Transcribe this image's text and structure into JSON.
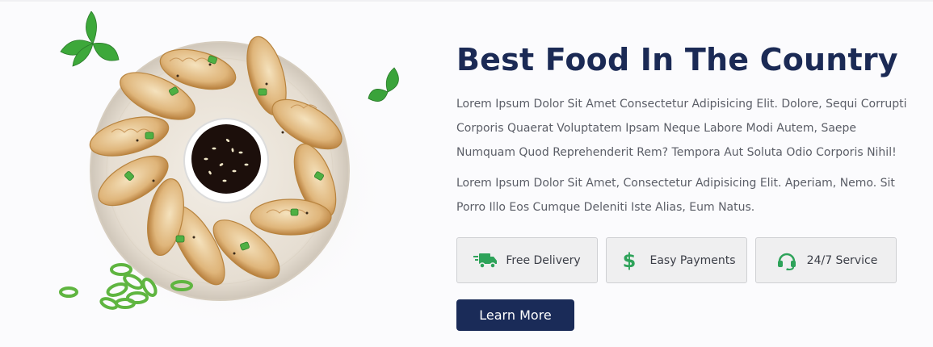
{
  "section": {
    "title": "Best Food In The Country",
    "paragraph_1": "Lorem Ipsum Dolor Sit Amet Consectetur Adipisicing Elit. Dolore, Sequi Corrupti Corporis Quaerat Voluptatem Ipsam Neque Labore Modi Autem, Saepe Numquam Quod Reprehenderit Rem? Tempora Aut Soluta Odio Corporis Nihil!",
    "paragraph_2": "Lorem Ipsum Dolor Sit Amet, Consectetur Adipisicing Elit. Aperiam, Nemo. Sit Porro Illo Eos Cumque Deleniti Iste Alias, Eum Natus.",
    "features": [
      {
        "label": "Free Delivery",
        "icon": "truck-icon"
      },
      {
        "label": "Easy Payments",
        "icon": "dollar-icon"
      },
      {
        "label": "24/7 Service",
        "icon": "headset-icon"
      }
    ],
    "cta_label": "Learn More"
  },
  "image": {
    "subject": "dumplings-plate-with-soy-sauce"
  },
  "colors": {
    "heading": "#1b2a55",
    "button_bg": "#1a2b58",
    "icon_accent": "#2ea35a",
    "feature_bg": "#efeff0"
  }
}
